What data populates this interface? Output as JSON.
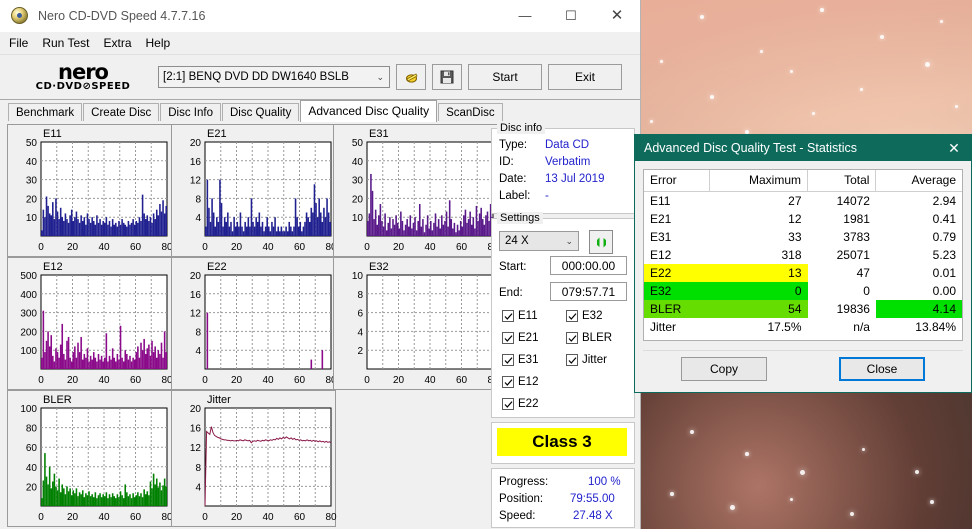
{
  "window": {
    "title": "Nero CD-DVD Speed 4.7.7.16",
    "icon": "nero-disc-icon",
    "minimize": "—",
    "maximize": "☐",
    "close": "✕"
  },
  "menu": {
    "items": [
      "File",
      "Run Test",
      "Extra",
      "Help"
    ]
  },
  "toolbar": {
    "logo_line1": "nero",
    "logo_line2": "CD·DVD⊘SPEED",
    "drive": "[2:1]   BENQ DVD DD DW1640 BSLB",
    "chevron": "⌄",
    "eject_icon": "eject-disc-icon",
    "save_icon": "floppy-save-icon",
    "start_label": "Start",
    "exit_label": "Exit"
  },
  "tabs": [
    {
      "label": "Benchmark",
      "active": false
    },
    {
      "label": "Create Disc",
      "active": false
    },
    {
      "label": "Disc Info",
      "active": false
    },
    {
      "label": "Disc Quality",
      "active": false
    },
    {
      "label": "Advanced Disc Quality",
      "active": true
    },
    {
      "label": "ScanDisc",
      "active": false
    }
  ],
  "disc_info": {
    "legend": "Disc info",
    "rows": [
      {
        "key": "Type:",
        "value": "Data CD"
      },
      {
        "key": "ID:",
        "value": "Verbatim"
      },
      {
        "key": "Date:",
        "value": "13 Jul 2019"
      },
      {
        "key": "Label:",
        "value": "-"
      }
    ]
  },
  "settings": {
    "legend": "Settings",
    "speed": "24 X",
    "chevron": "⌄",
    "refresh_icon": "refresh-arrows-icon",
    "start_label": "Start:",
    "start_value": "000:00.00",
    "end_label": "End:",
    "end_value": "079:57.71",
    "checkboxes_left": [
      {
        "label": "E11",
        "checked": true
      },
      {
        "label": "E21",
        "checked": true
      },
      {
        "label": "E31",
        "checked": true
      },
      {
        "label": "E12",
        "checked": true
      },
      {
        "label": "E22",
        "checked": true
      }
    ],
    "checkboxes_right": [
      {
        "label": "E32",
        "checked": true
      },
      {
        "label": "BLER",
        "checked": true
      },
      {
        "label": "Jitter",
        "checked": true
      }
    ]
  },
  "quality_class": {
    "label": "Class 3",
    "color": "#ffff00"
  },
  "progress": {
    "rows": [
      {
        "key": "Progress:",
        "value": "100 %"
      },
      {
        "key": "Position:",
        "value": "79:55.00"
      },
      {
        "key": "Speed:",
        "value": "27.48 X"
      }
    ]
  },
  "stats_dialog": {
    "title": "Advanced Disc Quality Test - Statistics",
    "close_icon": "✕",
    "columns": [
      "Error",
      "Maximum",
      "Total",
      "Average"
    ],
    "rows": [
      {
        "error": "E11",
        "maximum": "27",
        "total": "14072",
        "average": "2.94",
        "highlight": null,
        "avg_highlight": null
      },
      {
        "error": "E21",
        "maximum": "12",
        "total": "1981",
        "average": "0.41",
        "highlight": null,
        "avg_highlight": null
      },
      {
        "error": "E31",
        "maximum": "33",
        "total": "3783",
        "average": "0.79",
        "highlight": null,
        "avg_highlight": null
      },
      {
        "error": "E12",
        "maximum": "318",
        "total": "25071",
        "average": "5.23",
        "highlight": null,
        "avg_highlight": null
      },
      {
        "error": "E22",
        "maximum": "13",
        "total": "47",
        "average": "0.01",
        "highlight": "#ffff00",
        "avg_highlight": null
      },
      {
        "error": "E32",
        "maximum": "0",
        "total": "0",
        "average": "0.00",
        "highlight": "#00e000",
        "avg_highlight": null
      },
      {
        "error": "BLER",
        "maximum": "54",
        "total": "19836",
        "average": "4.14",
        "highlight": "#66dd00",
        "avg_highlight": "#00e000"
      },
      {
        "error": "Jitter",
        "maximum": "17.5%",
        "total": "n/a",
        "average": "13.84%",
        "highlight": null,
        "avg_highlight": null
      }
    ],
    "copy_label": "Copy",
    "close_label": "Close"
  },
  "chart_data": [
    {
      "id": "E11",
      "type": "area",
      "title": "E11",
      "color": "#202090",
      "xlabel": "",
      "ylabel": "",
      "xlim": [
        0,
        80
      ],
      "ylim": [
        0,
        50
      ],
      "xticks": [
        0,
        20,
        40,
        60,
        80
      ],
      "yticks": [
        10,
        20,
        30,
        40,
        50
      ],
      "grid": true,
      "values": [
        3,
        14,
        10,
        21,
        16,
        12,
        11,
        18,
        9,
        20,
        13,
        9,
        15,
        10,
        8,
        12,
        9,
        7,
        11,
        14,
        8,
        10,
        13,
        9,
        7,
        11,
        8,
        10,
        6,
        12,
        9,
        7,
        10,
        8,
        6,
        11,
        7,
        9,
        6,
        8,
        7,
        10,
        6,
        8,
        5,
        9,
        6,
        7,
        5,
        8,
        6,
        9,
        7,
        6,
        5,
        8,
        6,
        7,
        9,
        6,
        8,
        7,
        10,
        8,
        22,
        12,
        9,
        11,
        8,
        10,
        7,
        12,
        9,
        14,
        11,
        17,
        13,
        19,
        12,
        16
      ]
    },
    {
      "id": "E21",
      "type": "area",
      "title": "E21",
      "color": "#202090",
      "xlabel": "",
      "ylabel": "",
      "xlim": [
        0,
        80
      ],
      "ylim": [
        0,
        20
      ],
      "xticks": [
        0,
        20,
        40,
        60,
        80
      ],
      "yticks": [
        4,
        8,
        12,
        16,
        20
      ],
      "grid": true,
      "values": [
        2,
        12,
        6,
        3,
        8,
        5,
        2,
        4,
        3,
        12,
        7,
        2,
        4,
        3,
        5,
        2,
        3,
        1,
        4,
        2,
        3,
        2,
        5,
        2,
        1,
        3,
        2,
        4,
        2,
        8,
        3,
        2,
        4,
        3,
        5,
        2,
        3,
        1,
        2,
        4,
        2,
        1,
        3,
        2,
        4,
        1,
        2,
        1,
        2,
        1,
        1,
        2,
        1,
        3,
        2,
        1,
        2,
        8,
        4,
        2,
        3,
        1,
        2,
        3,
        5,
        4,
        3,
        6,
        5,
        11,
        7,
        4,
        8,
        5,
        3,
        6,
        4,
        8,
        5,
        3
      ]
    },
    {
      "id": "E31",
      "type": "area",
      "title": "E31",
      "color": "#5a1a8a",
      "xlabel": "",
      "ylabel": "",
      "xlim": [
        0,
        80
      ],
      "ylim": [
        0,
        50
      ],
      "xticks": [
        0,
        20,
        40,
        60,
        80
      ],
      "yticks": [
        10,
        20,
        30,
        40,
        50
      ],
      "grid": true,
      "values": [
        8,
        12,
        33,
        24,
        9,
        14,
        6,
        11,
        17,
        8,
        5,
        12,
        3,
        7,
        10,
        4,
        9,
        6,
        11,
        7,
        4,
        13,
        8,
        3,
        6,
        9,
        5,
        11,
        4,
        7,
        10,
        3,
        8,
        17,
        5,
        9,
        2,
        6,
        11,
        4,
        8,
        3,
        7,
        12,
        5,
        9,
        4,
        11,
        6,
        8,
        13,
        5,
        19,
        9,
        4,
        7,
        2,
        6,
        3,
        8,
        5,
        11,
        14,
        7,
        9,
        13,
        6,
        10,
        4,
        16,
        8,
        12,
        15,
        9,
        6,
        11,
        13,
        8,
        17,
        10
      ]
    },
    {
      "id": "E12",
      "type": "area",
      "title": "E12",
      "color": "#8a0a8a",
      "xlabel": "",
      "ylabel": "",
      "xlim": [
        0,
        80
      ],
      "ylim": [
        0,
        500
      ],
      "xticks": [
        0,
        20,
        40,
        60,
        80
      ],
      "yticks": [
        100,
        200,
        300,
        400,
        500
      ],
      "grid": true,
      "values": [
        60,
        310,
        90,
        150,
        200,
        120,
        180,
        70,
        40,
        110,
        90,
        60,
        130,
        240,
        80,
        50,
        150,
        170,
        60,
        40,
        90,
        120,
        60,
        140,
        90,
        170,
        50,
        80,
        60,
        110,
        40,
        70,
        50,
        90,
        60,
        40,
        80,
        50,
        70,
        40,
        60,
        190,
        40,
        70,
        50,
        110,
        60,
        40,
        80,
        50,
        230,
        60,
        40,
        100,
        80,
        50,
        70,
        40,
        60,
        50,
        90,
        120,
        60,
        140,
        100,
        160,
        80,
        110,
        130,
        70,
        150,
        90,
        120,
        60,
        100,
        80,
        140,
        60,
        200,
        90
      ]
    },
    {
      "id": "E22",
      "type": "area",
      "title": "E22",
      "color": "#8a0a8a",
      "xlabel": "",
      "ylabel": "",
      "xlim": [
        0,
        80
      ],
      "ylim": [
        0,
        20
      ],
      "xticks": [
        0,
        20,
        40,
        60,
        80
      ],
      "yticks": [
        4,
        8,
        12,
        16,
        20
      ],
      "grid": true,
      "values": [
        0,
        12,
        0,
        0,
        0,
        0,
        0,
        0,
        0,
        0,
        0,
        0,
        0,
        0,
        0,
        0,
        0,
        0,
        0,
        0,
        0,
        0,
        0,
        0,
        0,
        0,
        0,
        0,
        0,
        0,
        0,
        0,
        0,
        0,
        0,
        0,
        0,
        0,
        0,
        0,
        0,
        0,
        0,
        0,
        0,
        0,
        0,
        0,
        0,
        0,
        0,
        0,
        0,
        0,
        0,
        0,
        0,
        0,
        0,
        0,
        0,
        0,
        0,
        0,
        0,
        0,
        0,
        2,
        0,
        0,
        0,
        0,
        0,
        0,
        4,
        0,
        0,
        0,
        0,
        0
      ]
    },
    {
      "id": "E32",
      "type": "area",
      "title": "E32",
      "color": "#8a0a8a",
      "xlabel": "",
      "ylabel": "",
      "xlim": [
        0,
        80
      ],
      "ylim": [
        0,
        10
      ],
      "xticks": [
        0,
        20,
        40,
        60,
        80
      ],
      "yticks": [
        2,
        4,
        6,
        8,
        10
      ],
      "grid": true,
      "values": []
    },
    {
      "id": "BLER",
      "type": "area",
      "title": "BLER",
      "color": "#008000",
      "xlabel": "",
      "ylabel": "",
      "xlim": [
        0,
        80
      ],
      "ylim": [
        0,
        100
      ],
      "xticks": [
        0,
        20,
        40,
        60,
        80
      ],
      "yticks": [
        20,
        40,
        60,
        80,
        100
      ],
      "grid": true,
      "values": [
        8,
        26,
        54,
        30,
        22,
        40,
        18,
        25,
        33,
        20,
        16,
        28,
        14,
        22,
        18,
        12,
        20,
        15,
        18,
        11,
        16,
        13,
        18,
        10,
        14,
        12,
        16,
        9,
        13,
        11,
        15,
        10,
        12,
        9,
        14,
        8,
        11,
        13,
        9,
        12,
        10,
        14,
        8,
        12,
        9,
        13,
        10,
        8,
        12,
        9,
        15,
        11,
        8,
        22,
        14,
        10,
        12,
        8,
        13,
        9,
        11,
        14,
        10,
        13,
        9,
        17,
        12,
        15,
        11,
        25,
        18,
        33,
        22,
        28,
        19,
        24,
        16,
        21,
        28,
        20
      ]
    },
    {
      "id": "Jitter",
      "type": "line",
      "title": "Jitter",
      "color": "#8b1a4a",
      "xlabel": "",
      "ylabel": "",
      "xlim": [
        0,
        80
      ],
      "ylim": [
        0,
        20
      ],
      "xticks": [
        0,
        20,
        40,
        60,
        80
      ],
      "yticks": [
        4,
        8,
        12,
        16,
        20
      ],
      "grid": true,
      "values": [
        0,
        15.2,
        14.9,
        14.6,
        16.2,
        15.0,
        14.4,
        14.2,
        14.0,
        13.9,
        13.7,
        13.6,
        13.5,
        13.5,
        13.4,
        13.4,
        13.3,
        13.4,
        13.3,
        13.3,
        13.4,
        13.3,
        13.5,
        13.4,
        13.3,
        13.5,
        13.4,
        13.3,
        13.4,
        12.9,
        13.2,
        13.3,
        13.2,
        13.4,
        13.3,
        13.2,
        13.4,
        13.3,
        13.5,
        13.4,
        13.3,
        13.5,
        13.4,
        13.6,
        13.5,
        13.8,
        13.6,
        13.9,
        13.7,
        14.0,
        13.8,
        14.1,
        13.9,
        13.7,
        13.9,
        13.6,
        13.8,
        13.5,
        13.6,
        13.4,
        13.5,
        13.3,
        13.4,
        13.3,
        13.5,
        13.3,
        13.4,
        13.2,
        13.4,
        13.2,
        13.3,
        13.1,
        13.3,
        13.1,
        13.2,
        13.0,
        13.2,
        13.0,
        13.1,
        12.9
      ]
    }
  ]
}
